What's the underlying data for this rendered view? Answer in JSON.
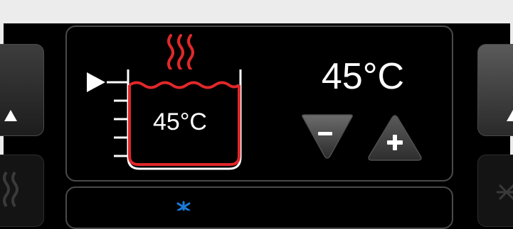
{
  "display": {
    "current_temperature": "45°C",
    "set_temperature": "45°C"
  },
  "controls": {
    "decrease_icon": "minus-triangle-down",
    "increase_icon": "plus-triangle-up"
  },
  "icons": {
    "heat": "heat-waves-icon",
    "pot": "pot-icon",
    "level_marker": "play-triangle-icon",
    "snowflake": "snowflake-icon"
  },
  "colors": {
    "heat_red": "#e0282a",
    "frost_blue": "#1a7ad8",
    "panel_border": "#4a4a4a",
    "background": "#000000",
    "frame": "#ececec"
  }
}
